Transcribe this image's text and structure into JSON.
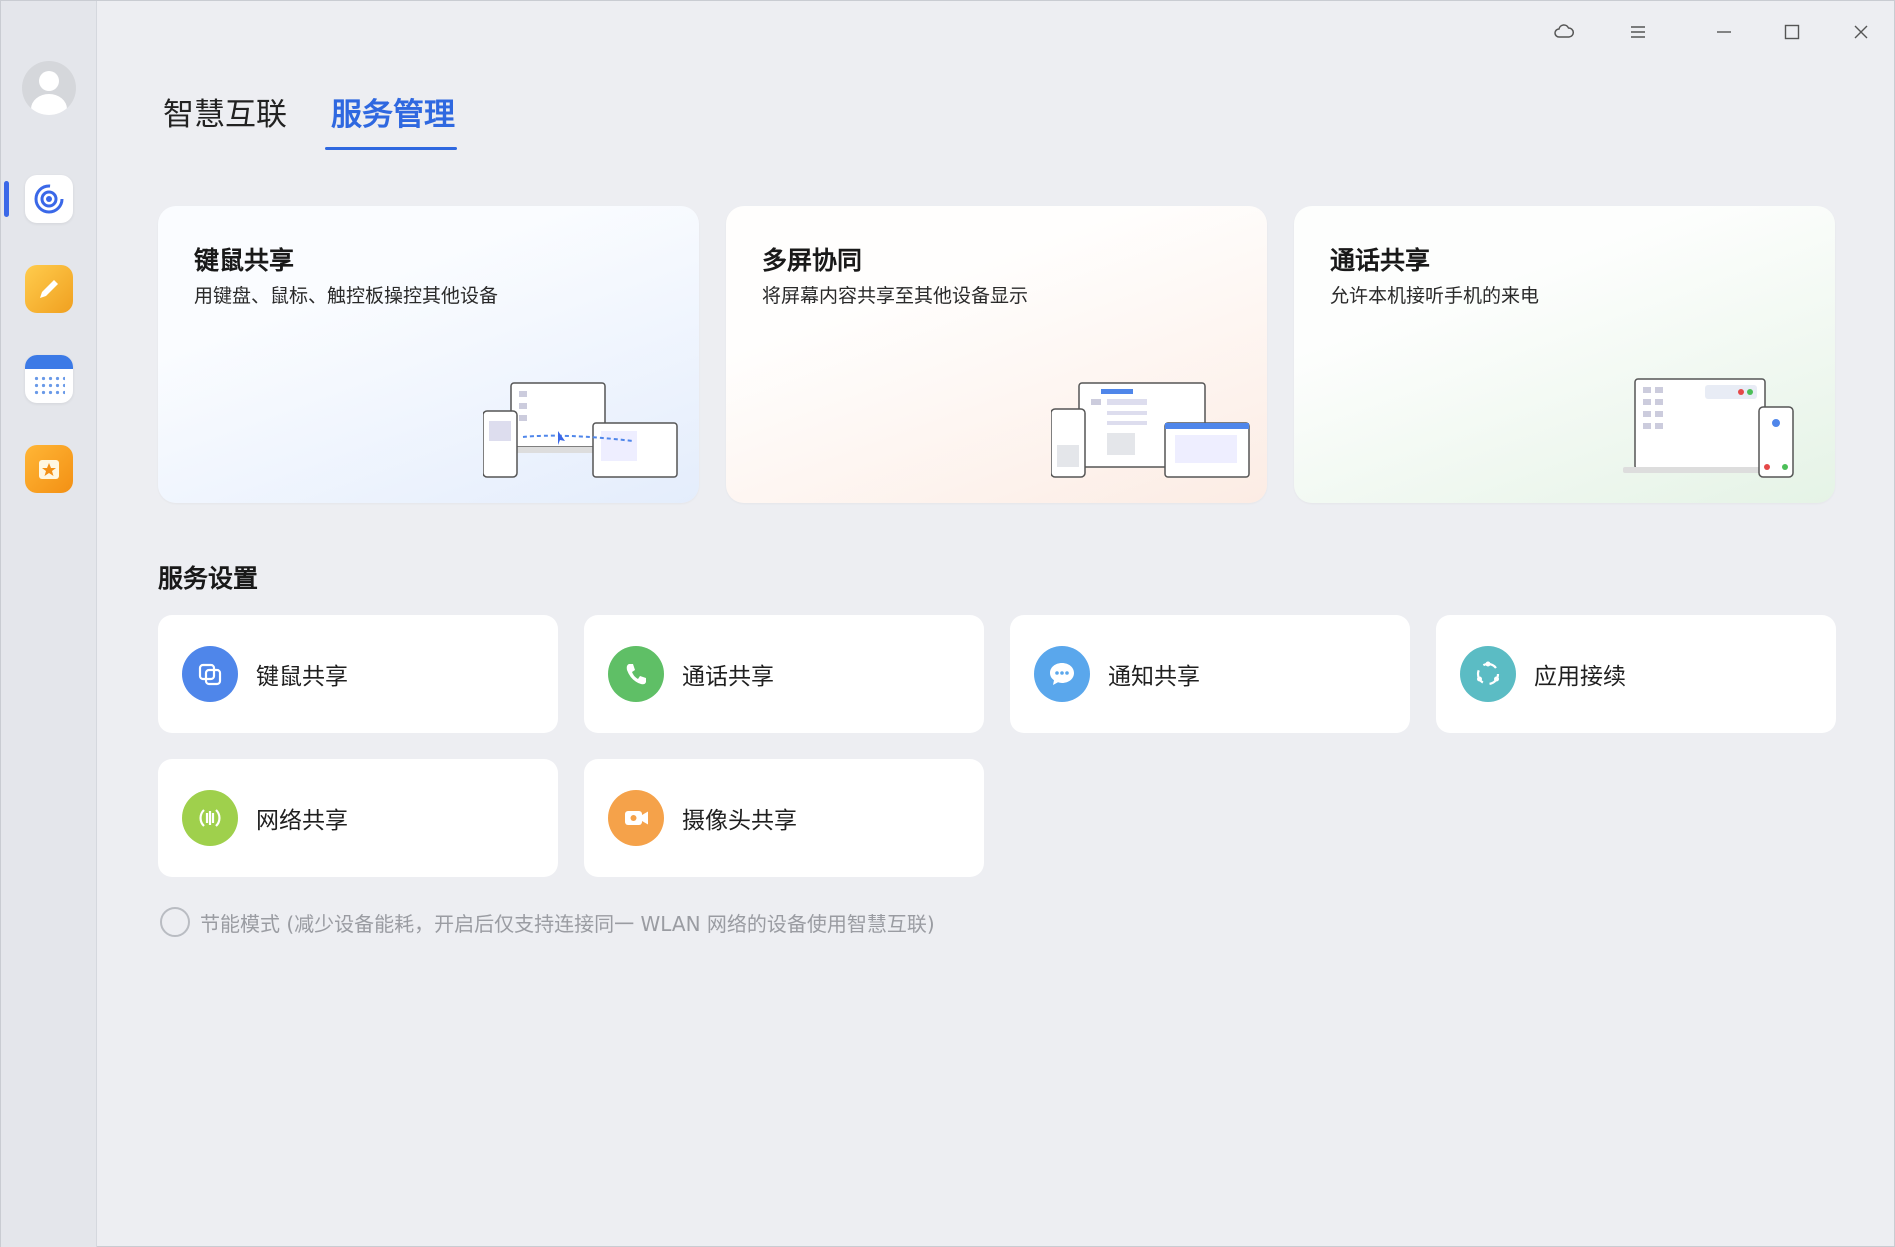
{
  "titlebar": {
    "cloud_icon": "cloud-sync-icon",
    "menu_icon": "menu-icon",
    "minimize_icon": "minimize-icon",
    "maximize_icon": "maximize-icon",
    "close_icon": "close-icon"
  },
  "sidebar": {
    "items": [
      {
        "name": "avatar"
      },
      {
        "name": "smart-connect-app",
        "active": true
      },
      {
        "name": "notes-app"
      },
      {
        "name": "calendar-app"
      },
      {
        "name": "favorites-app"
      }
    ]
  },
  "tabs": [
    {
      "label": "智慧互联",
      "active": false
    },
    {
      "label": "服务管理",
      "active": true
    }
  ],
  "features": [
    {
      "title": "键鼠共享",
      "desc": "用键盘、鼠标、触控板操控其他设备"
    },
    {
      "title": "多屏协同",
      "desc": "将屏幕内容共享至其他设备显示"
    },
    {
      "title": "通话共享",
      "desc": "允许本机接听手机的来电"
    }
  ],
  "section": {
    "title": "服务设置"
  },
  "services": [
    {
      "label": "键鼠共享",
      "icon": "keyboard-mouse-share-icon",
      "color": "#4f86ea"
    },
    {
      "label": "通话共享",
      "icon": "phone-icon",
      "color": "#5fbf66"
    },
    {
      "label": "通知共享",
      "icon": "chat-bubble-icon",
      "color": "#5aa7ec"
    },
    {
      "label": "应用接续",
      "icon": "app-relay-icon",
      "color": "#5bbcc4"
    },
    {
      "label": "网络共享",
      "icon": "network-share-icon",
      "color": "#9fd04c"
    },
    {
      "label": "摄像头共享",
      "icon": "camera-icon",
      "color": "#f5a24a"
    }
  ],
  "power_save": {
    "label": "节能模式 (减少设备能耗，开启后仅支持连接同一 WLAN 网络的设备使用智慧互联)",
    "checked": false
  },
  "colors": {
    "accent": "#2f68e0",
    "background": "#edeef2"
  }
}
